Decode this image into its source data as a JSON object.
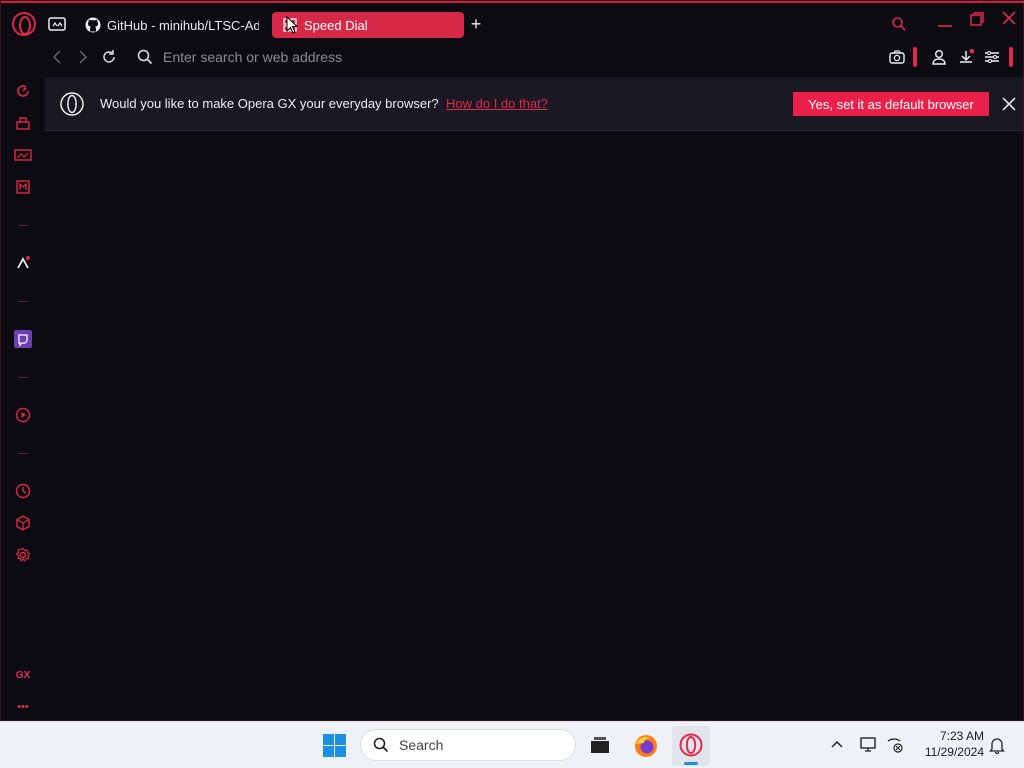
{
  "tabs": [
    {
      "label": "GitHub - minihub/LTSC-Ad",
      "icon": "github-icon",
      "active": false
    },
    {
      "label": "Speed Dial",
      "icon": "speed-dial-icon",
      "active": true
    }
  ],
  "address": {
    "placeholder": "Enter search or web address"
  },
  "banner": {
    "text": "Would you like to make Opera GX your everyday browser?",
    "link": "How do I do that?",
    "button": "Yes, set it as default browser"
  },
  "sidebar": {
    "items": [
      "speed-dial-icon",
      "gx-control-icon",
      "gx-corner-icon",
      "gx-music-icon",
      "aria-icon",
      "twitch-icon",
      "player-icon",
      "history-icon",
      "extensions-icon",
      "settings-icon"
    ],
    "gx_label": "GX",
    "more_label": "•••"
  },
  "taskbar": {
    "search_label": "Search",
    "time": "7:23 AM",
    "date": "11/29/2024"
  },
  "colors": {
    "accent": "#e0284a",
    "background": "#0c0b12",
    "banner": "#1a1923"
  }
}
